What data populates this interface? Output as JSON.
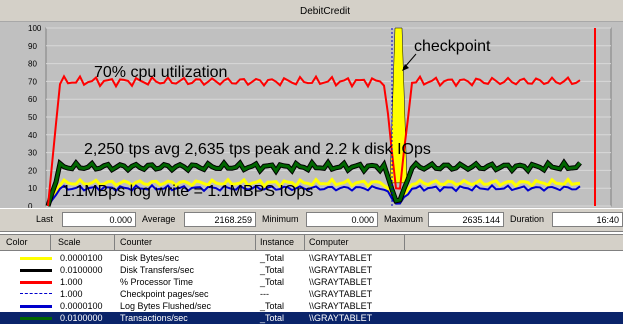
{
  "window": {
    "title": "DebitCredit"
  },
  "chart": {
    "y_ticks": [
      "100",
      "90",
      "80",
      "70",
      "60",
      "50",
      "40",
      "30",
      "20",
      "10",
      "0"
    ],
    "annotations": {
      "cpu": "70% cpu utilization",
      "checkpoint": "checkpoint",
      "tps": "2,250 tps avg 2,635 tps peak and 2.2 k disk IOps",
      "log": "1.1MBps log write = 1.1MBPS IOps"
    },
    "colors": {
      "background": "#c0c0c0",
      "cpu": "#ff0000",
      "transactions": "#006600",
      "disk_bytes": "#ffff00",
      "disk_transfers": "#000000",
      "log_bytes": "#0000cc",
      "checkpoint": "#0000cc"
    }
  },
  "chart_data": {
    "type": "line",
    "ylim": [
      0,
      100
    ],
    "grid": true,
    "series": [
      {
        "name": "% Processor Time",
        "level": 70,
        "color": "#ff0000"
      },
      {
        "name": "Transactions/sec",
        "level": 22,
        "color": "#006600"
      },
      {
        "name": "Disk Bytes/sec",
        "level": 13,
        "color": "#ffff00"
      },
      {
        "name": "Log Bytes Flushed/sec",
        "level": 10,
        "color": "#0000cc"
      }
    ]
  },
  "stats": {
    "last_label": "Last",
    "last_value": "0.000",
    "average_label": "Average",
    "average_value": "2168.259",
    "minimum_label": "Minimum",
    "minimum_value": "0.000",
    "maximum_label": "Maximum",
    "maximum_value": "2635.144",
    "duration_label": "Duration",
    "duration_value": "16:40"
  },
  "legend": {
    "headers": {
      "color": "Color",
      "scale": "Scale",
      "counter": "Counter",
      "instance": "Instance",
      "computer": "Computer"
    },
    "rows": [
      {
        "scale": "0.0000100",
        "counter": "Disk Bytes/sec",
        "instance": "_Total",
        "computer": "\\\\GRAYTABLET",
        "color": "#ffff00",
        "style": "solid",
        "selected": false
      },
      {
        "scale": "0.0100000",
        "counter": "Disk Transfers/sec",
        "instance": "_Total",
        "computer": "\\\\GRAYTABLET",
        "color": "#000000",
        "style": "solid",
        "selected": false
      },
      {
        "scale": "1.000",
        "counter": "% Processor Time",
        "instance": "_Total",
        "computer": "\\\\GRAYTABLET",
        "color": "#ff0000",
        "style": "solid",
        "selected": false
      },
      {
        "scale": "1.000",
        "counter": "Checkpoint pages/sec",
        "instance": "---",
        "computer": "\\\\GRAYTABLET",
        "color": "#0000cc",
        "style": "dashed",
        "selected": false
      },
      {
        "scale": "0.0000100",
        "counter": "Log Bytes Flushed/sec",
        "instance": "_Total",
        "computer": "\\\\GRAYTABLET",
        "color": "#0000cc",
        "style": "solid",
        "selected": false
      },
      {
        "scale": "0.0100000",
        "counter": "Transactions/sec",
        "instance": "_Total",
        "computer": "\\\\GRAYTABLET",
        "color": "#006600",
        "style": "solid",
        "selected": true
      }
    ]
  }
}
